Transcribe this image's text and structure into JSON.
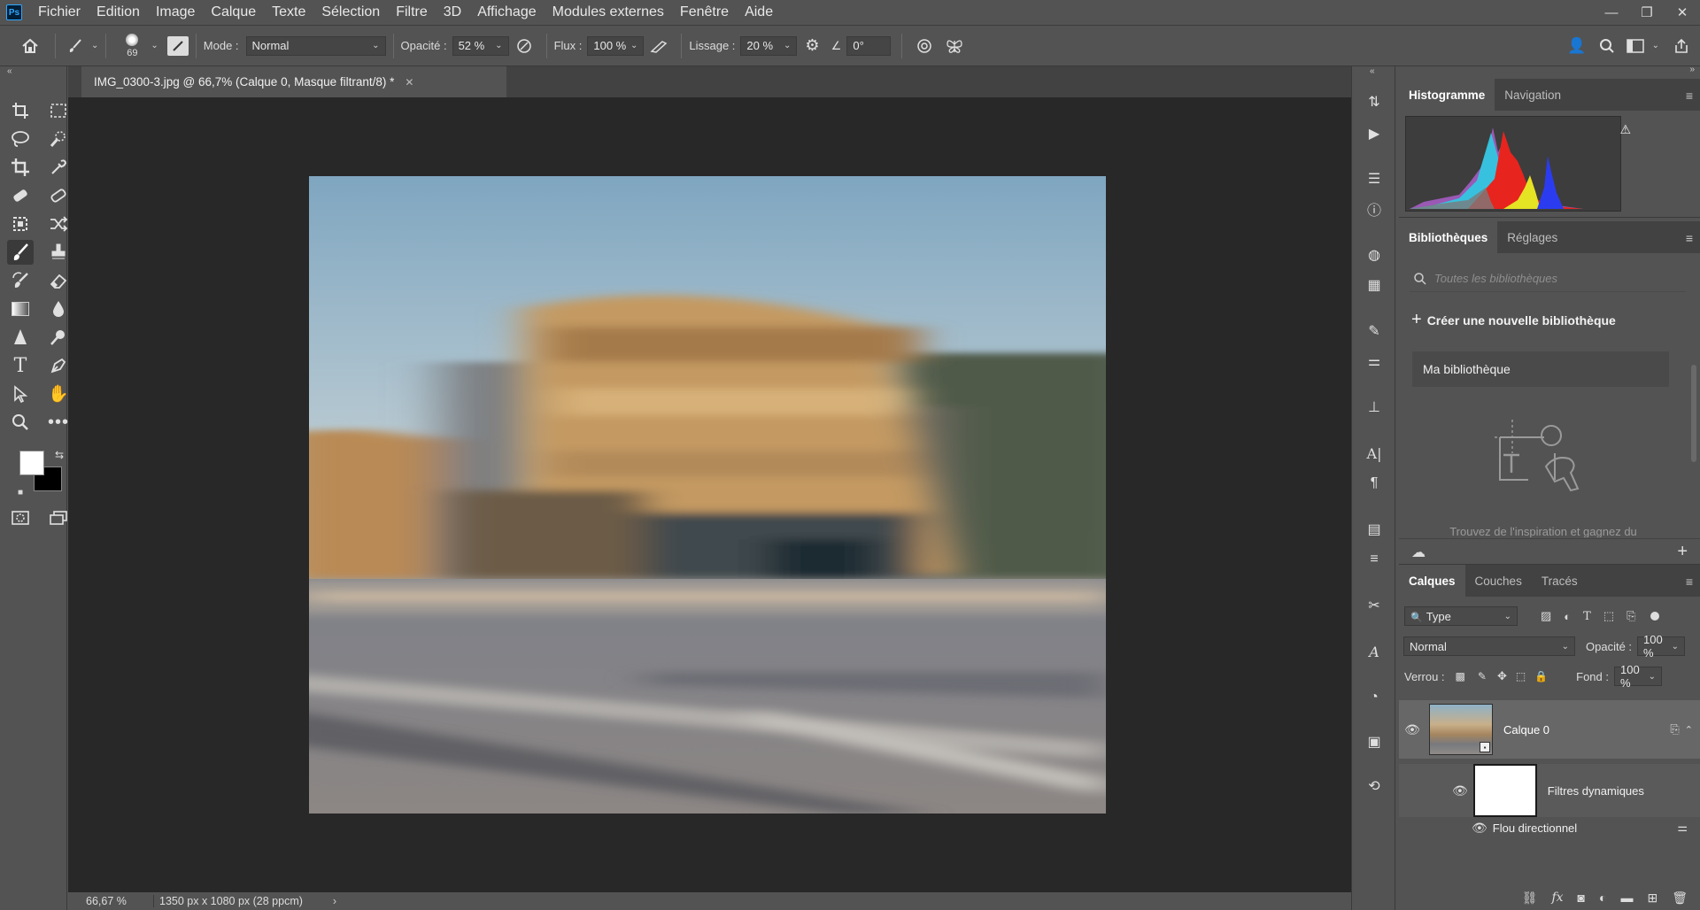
{
  "menubar": {
    "logo": "Ps",
    "items": [
      "Fichier",
      "Edition",
      "Image",
      "Calque",
      "Texte",
      "Sélection",
      "Filtre",
      "3D",
      "Affichage",
      "Modules externes",
      "Fenêtre",
      "Aide"
    ]
  },
  "options": {
    "brush_size": "69",
    "mode_label": "Mode :",
    "mode_value": "Normal",
    "opacity_label": "Opacité :",
    "opacity_value": "52 %",
    "flow_label": "Flux :",
    "flow_value": "100 %",
    "smoothing_label": "Lissage :",
    "smoothing_value": "20 %",
    "angle_value": "0°"
  },
  "document": {
    "tab_title": "IMG_0300-3.jpg @ 66,7% (Calque 0, Masque filtrant/8) *",
    "zoom": "66,67 %",
    "doc_info": "1350 px x 1080 px (28 ppcm)"
  },
  "histogram_panel": {
    "tabs": [
      "Histogramme",
      "Navigation"
    ]
  },
  "libraries_panel": {
    "tabs": [
      "Bibliothèques",
      "Réglages"
    ],
    "search_placeholder": "Toutes les bibliothèques",
    "create_label": "Créer une nouvelle bibliothèque",
    "library_name": "Ma bibliothèque",
    "promo_text": "Trouvez de l'inspiration et gagnez du"
  },
  "layers_panel": {
    "tabs": [
      "Calques",
      "Couches",
      "Tracés"
    ],
    "filter_value": "Type",
    "blend_mode": "Normal",
    "opacity_label": "Opacité :",
    "opacity_value": "100 %",
    "lock_label": "Verrou :",
    "fill_label": "Fond :",
    "fill_value": "100 %",
    "layer_name": "Calque 0",
    "smart_filters_label": "Filtres dynamiques",
    "filter_name": "Flou directionnel"
  },
  "colors": {
    "ui_bg": "#535353",
    "canvas_bg": "#282828",
    "foreground": "#ffffff",
    "background": "#000000"
  }
}
